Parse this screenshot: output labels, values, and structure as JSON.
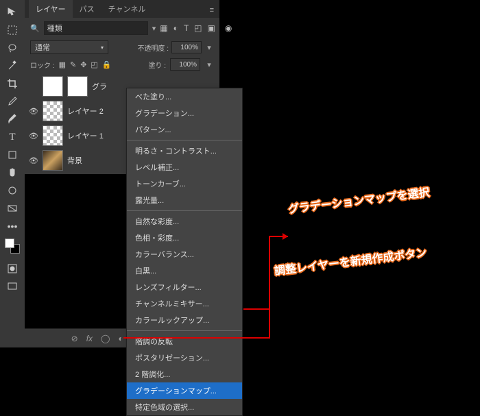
{
  "tabs": {
    "layers": "レイヤー",
    "paths": "パス",
    "channels": "チャンネル"
  },
  "search": {
    "placeholder": "種類"
  },
  "blend": {
    "mode": "通常",
    "opacity_label": "不透明度 :",
    "opacity": "100%",
    "fill_label": "塗り :",
    "fill": "100%",
    "lock_label": "ロック :"
  },
  "layers_list": [
    {
      "name": "グラ",
      "eye": false,
      "thumb": "white"
    },
    {
      "name": "レイヤー 2",
      "eye": true,
      "thumb": "checker"
    },
    {
      "name": "レイヤー 1",
      "eye": true,
      "thumb": "checker"
    },
    {
      "name": "背景",
      "eye": true,
      "thumb": "img"
    }
  ],
  "menu": {
    "g1": [
      "べた塗り...",
      "グラデーション...",
      "パターン..."
    ],
    "g2": [
      "明るさ・コントラスト...",
      "レベル補正...",
      "トーンカーブ...",
      "露光量..."
    ],
    "g3": [
      "自然な彩度...",
      "色相・彩度...",
      "カラーバランス...",
      "白黒...",
      "レンズフィルター...",
      "チャンネルミキサー...",
      "カラールックアップ..."
    ],
    "g4": [
      "階調の反転",
      "ポスタリゼーション...",
      "2 階調化...",
      "グラデーションマップ...",
      "特定色域の選択..."
    ]
  },
  "menu_highlight": "グラデーションマップ...",
  "annotations": {
    "a1": "グラデーションマップを選択",
    "a2": "調整レイヤーを新規作成ボタン"
  }
}
